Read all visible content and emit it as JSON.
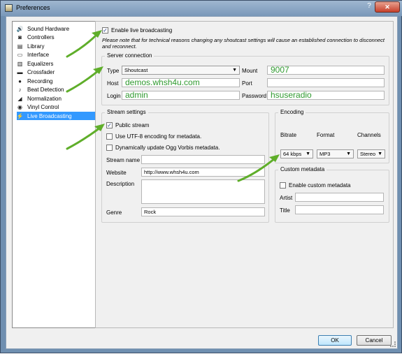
{
  "window": {
    "title": "Preferences",
    "help_symbol": "?",
    "close_symbol": "✕"
  },
  "sidebar": {
    "items": [
      {
        "label": "Sound Hardware",
        "icon": "speaker-icon",
        "glyph": "🔊"
      },
      {
        "label": "Controllers",
        "icon": "controller-icon",
        "glyph": "◙"
      },
      {
        "label": "Library",
        "icon": "library-icon",
        "glyph": "▤"
      },
      {
        "label": "Interface",
        "icon": "monitor-icon",
        "glyph": "▭"
      },
      {
        "label": "Equalizers",
        "icon": "equalizer-icon",
        "glyph": "▥"
      },
      {
        "label": "Crossfader",
        "icon": "crossfader-icon",
        "glyph": "▬"
      },
      {
        "label": "Recording",
        "icon": "recording-icon",
        "glyph": "●"
      },
      {
        "label": "Beat Detection",
        "icon": "beat-detection-icon",
        "glyph": "♪"
      },
      {
        "label": "Normalization",
        "icon": "normalization-icon",
        "glyph": "◢"
      },
      {
        "label": "Vinyl Control",
        "icon": "vinyl-icon",
        "glyph": "◉"
      },
      {
        "label": "Live Broadcasting",
        "icon": "broadcast-icon",
        "glyph": "⚡"
      }
    ]
  },
  "live": {
    "enable_label": "Enable live broadcasting",
    "enable_checked": true,
    "note": "Please note that for technical reasons changing any shoutcast settings will cause an established connection to disconnect and reconnect."
  },
  "server": {
    "title": "Server connection",
    "type_label": "Type",
    "type_value": "Shoutcast",
    "mount_label": "Mount",
    "mount_value": "9007",
    "host_label": "Host",
    "host_value": "demos.whsh4u.com",
    "port_label": "Port",
    "port_value": "",
    "login_label": "Login",
    "login_value": "admin",
    "password_label": "Password",
    "password_value": "hsuseradio"
  },
  "stream": {
    "title": "Stream settings",
    "public_label": "Public stream",
    "public_checked": true,
    "utf8_label": "Use UTF-8 encoding for metadata.",
    "utf8_checked": false,
    "ogg_label": "Dynamically update Ogg Vorbis metadata.",
    "ogg_checked": false,
    "name_label": "Stream name",
    "name_value": "",
    "website_label": "Website",
    "website_value": "http://www.whsh4u.com",
    "description_label": "Description",
    "description_value": "",
    "genre_label": "Genre",
    "genre_value": "Rock"
  },
  "encoding": {
    "title": "Encoding",
    "bitrate_label": "Bitrate",
    "format_label": "Format",
    "channels_label": "Channels",
    "bitrate_value": "64 kbps",
    "format_value": "MP3",
    "channels_value": "Stereo"
  },
  "custom_metadata": {
    "title": "Custom metadata",
    "enable_label": "Enable custom metadata",
    "enable_checked": false,
    "artist_label": "Artist",
    "artist_value": "",
    "title_label": "Title",
    "title_value": ""
  },
  "buttons": {
    "ok": "OK",
    "cancel": "Cancel"
  },
  "colors": {
    "accent_green": "#5fae2a",
    "selection": "#3399ff",
    "value_green": "#2f9a2f"
  }
}
